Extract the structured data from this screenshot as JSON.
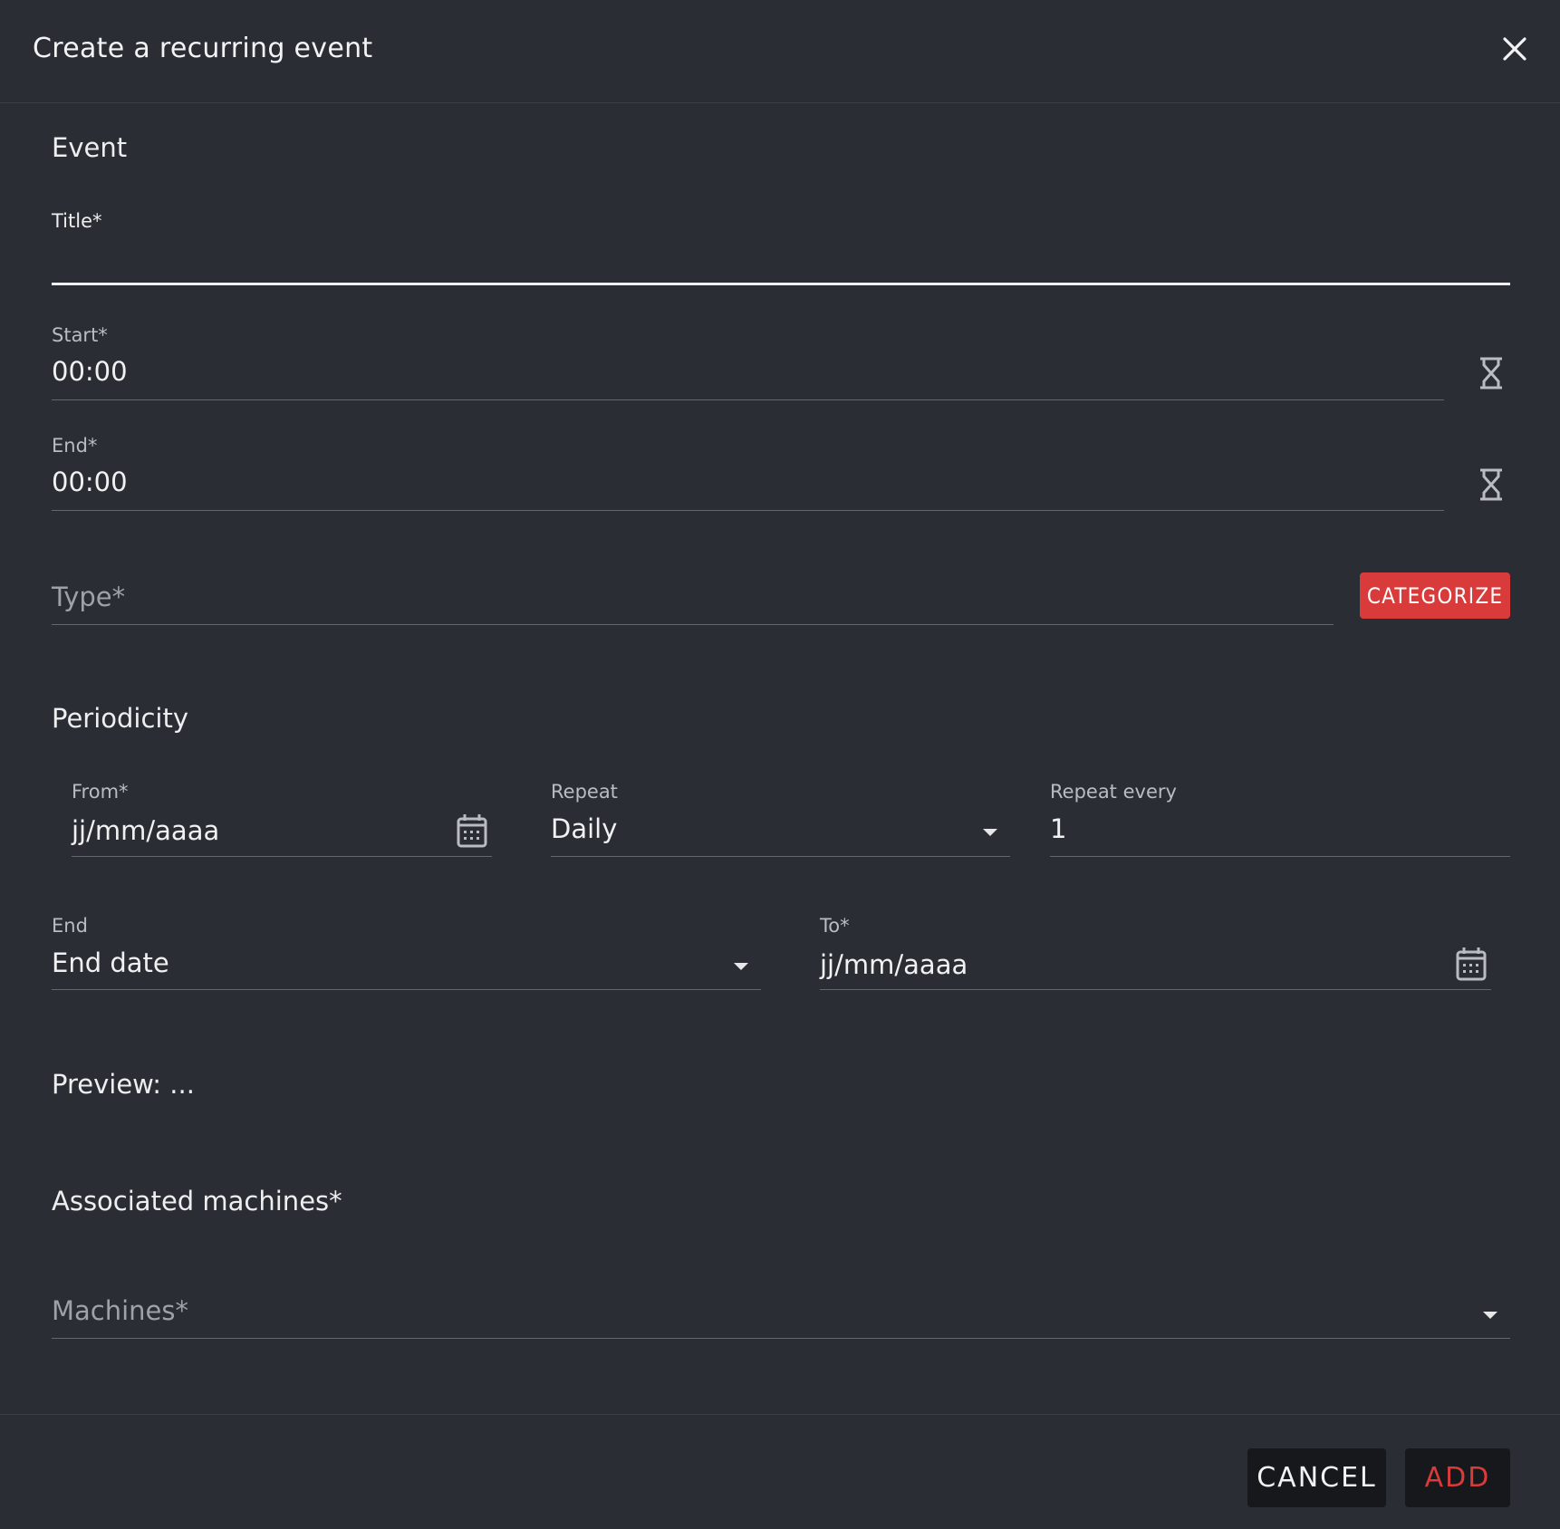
{
  "dialog": {
    "title": "Create a recurring event"
  },
  "event": {
    "section_title": "Event",
    "title_label": "Title*",
    "title_value": "",
    "start_label": "Start*",
    "start_value": "00:00",
    "end_label": "End*",
    "end_value": "00:00",
    "type_placeholder": "Type*",
    "categorize_label": "CATEGORIZE"
  },
  "periodicity": {
    "section_title": "Periodicity",
    "from_label": "From*",
    "from_value": "jj/mm/aaaa",
    "repeat_label": "Repeat",
    "repeat_value": "Daily",
    "repeat_every_label": "Repeat every",
    "repeat_every_value": "1",
    "end_label": "End",
    "end_value": "End date",
    "to_label": "To*",
    "to_value": "jj/mm/aaaa",
    "preview_text": "Preview: ..."
  },
  "machines": {
    "section_title": "Associated machines*",
    "placeholder": "Machines*"
  },
  "footer": {
    "cancel_label": "CANCEL",
    "add_label": "ADD"
  },
  "icons": {
    "close": "close-icon",
    "hourglass": "hourglass-icon",
    "calendar": "calendar-icon",
    "dropdown": "chevron-down-icon"
  },
  "colors": {
    "background": "#2a2d33",
    "accent": "#d93a3a",
    "footer_button_bg": "#17181b"
  }
}
